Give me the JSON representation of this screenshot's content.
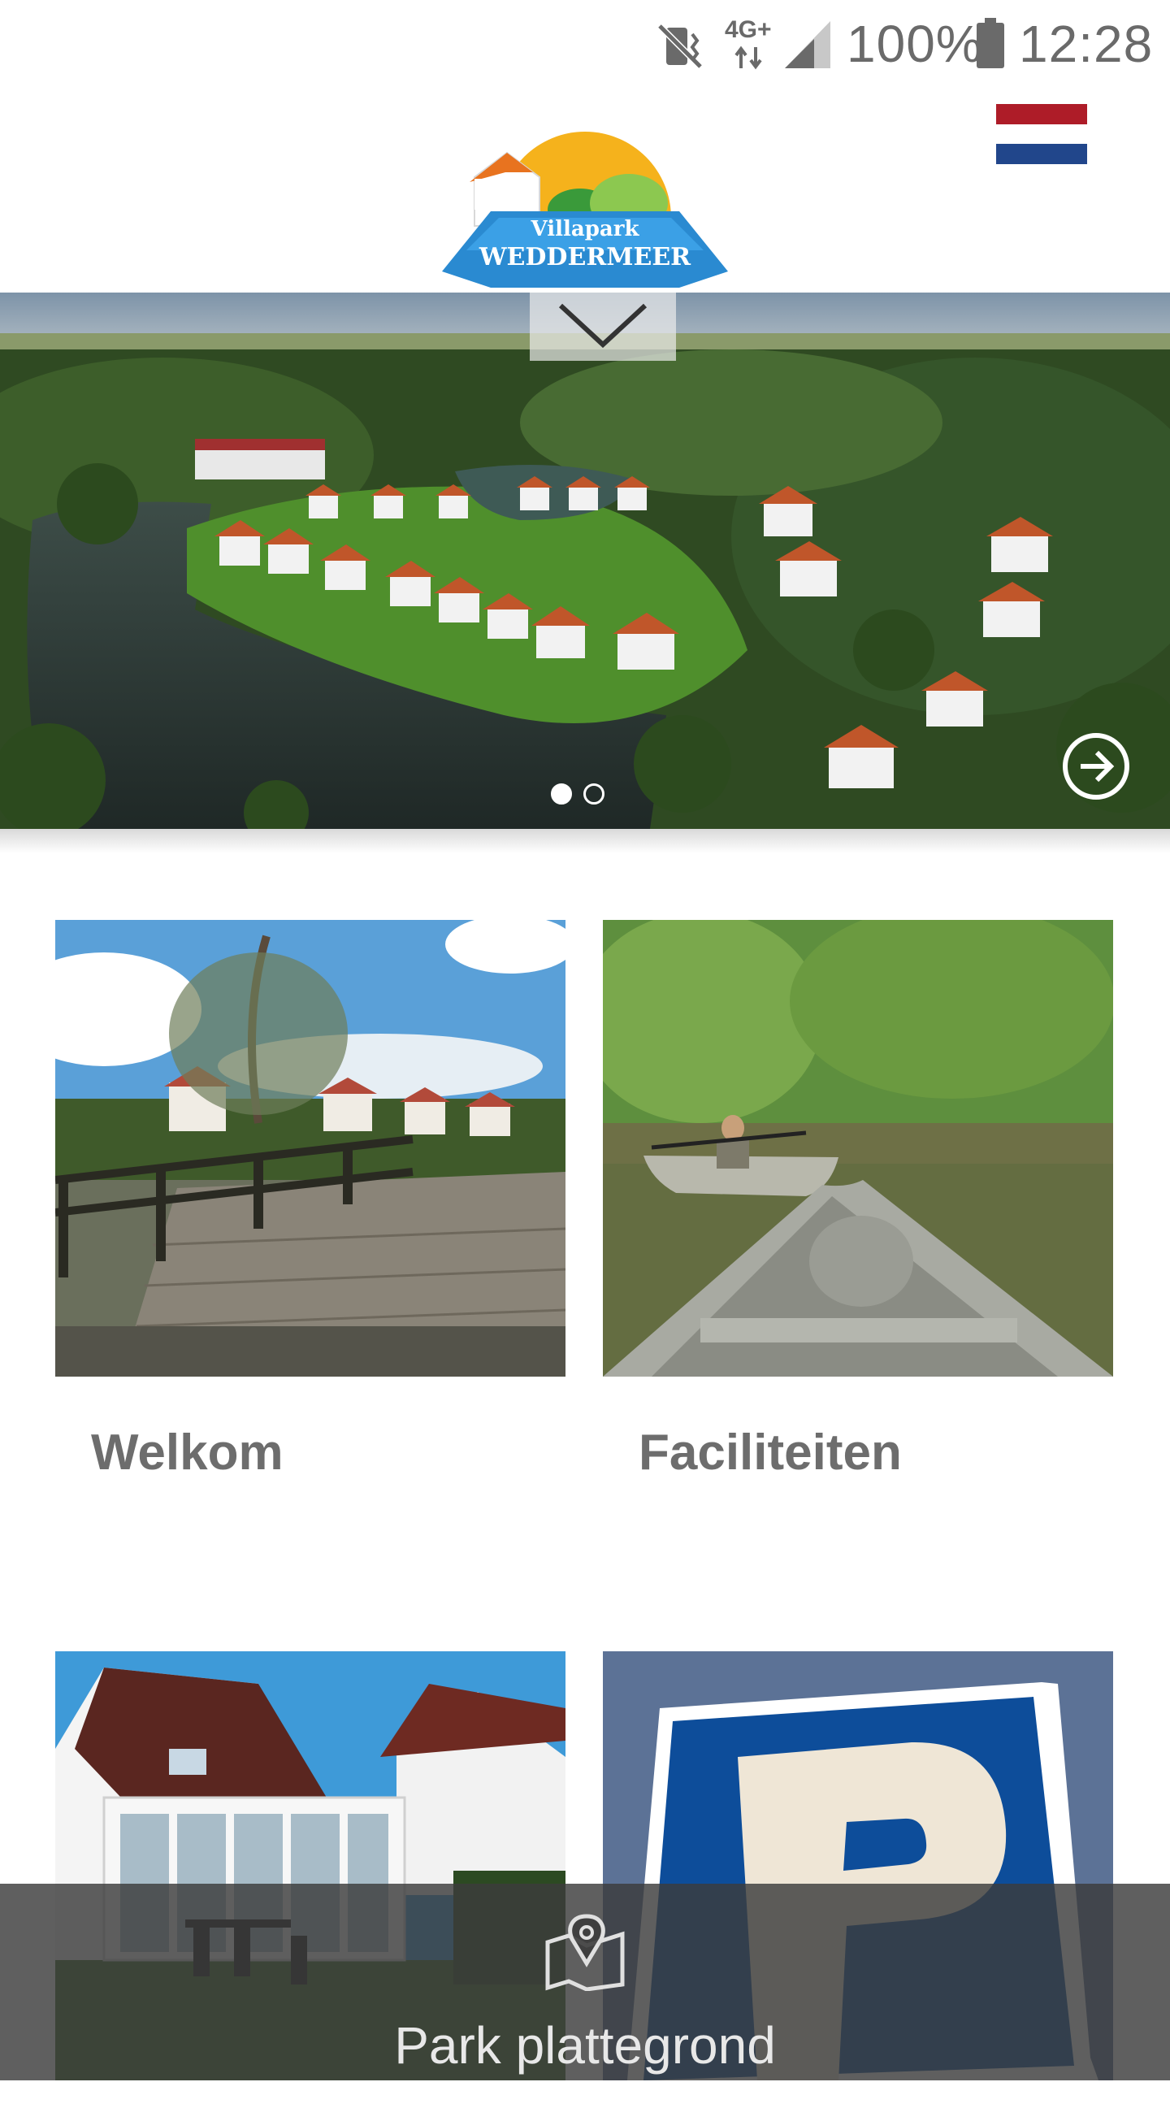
{
  "status_bar": {
    "network": "4G+",
    "battery": "100%",
    "time": "12:28"
  },
  "header": {
    "logo_text_top": "Villapark",
    "logo_text_bottom": "WEDDERMEER",
    "language_flag": "netherlands-flag"
  },
  "hero": {
    "slide_count": 2,
    "active_slide": 1
  },
  "tiles": [
    {
      "label": "Welkom"
    },
    {
      "label": "Faciliteiten"
    }
  ],
  "bottom_bar": {
    "label": "Park plattegrond",
    "icon": "map-pin-icon"
  },
  "colors": {
    "flag_red": "#ae1c28",
    "flag_blue": "#21468b",
    "tile_title": "#6d6d6d"
  }
}
